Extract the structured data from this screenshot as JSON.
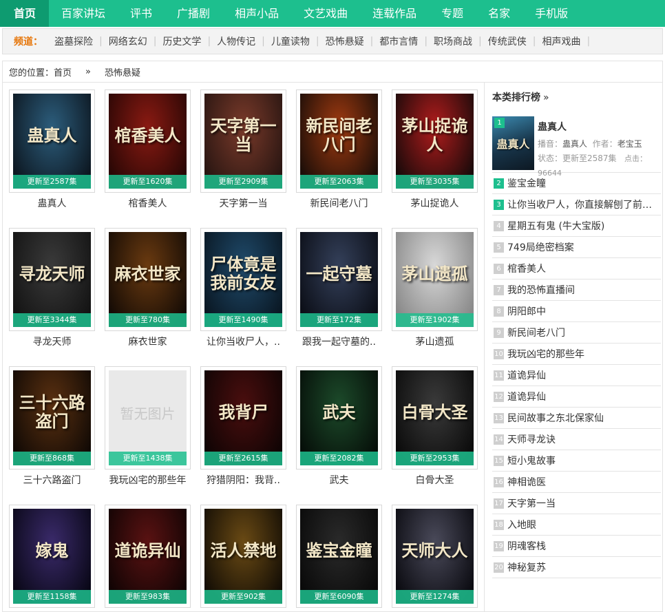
{
  "nav": [
    {
      "label": "首页",
      "active": true
    },
    {
      "label": "百家讲坛"
    },
    {
      "label": "评书"
    },
    {
      "label": "广播剧"
    },
    {
      "label": "相声小品"
    },
    {
      "label": "文艺戏曲"
    },
    {
      "label": "连载作品"
    },
    {
      "label": "专题"
    },
    {
      "label": "名家"
    },
    {
      "label": "手机版"
    }
  ],
  "channel": {
    "label": "频道：",
    "items": [
      "盗墓探险",
      "网络玄幻",
      "历史文学",
      "人物传记",
      "儿童读物",
      "恐怖悬疑",
      "都市言情",
      "职场商战",
      "传统武侠",
      "相声戏曲"
    ]
  },
  "breadcrumb": {
    "prefix": "您的位置：",
    "home": "首页",
    "arrow": "»",
    "current": "恐怖悬疑"
  },
  "books": [
    {
      "title": "蛊真人",
      "update": "更新至2587集",
      "art": "蛊真人",
      "bg": [
        "#2c5d7c",
        "#0d1822"
      ]
    },
    {
      "title": "棺香美人",
      "update": "更新至1620集",
      "art": "棺香美人",
      "bg": [
        "#8a1a12",
        "#2a0705"
      ]
    },
    {
      "title": "天字第一当",
      "update": "更新至2909集",
      "art": "天字第一当",
      "bg": [
        "#7a3a2a",
        "#2a1612"
      ]
    },
    {
      "title": "新民间老八门",
      "update": "更新至2063集",
      "art": "新民间老八门",
      "bg": [
        "#a03a10",
        "#1c0e08"
      ]
    },
    {
      "title": "茅山捉诡人",
      "update": "更新至3035集",
      "art": "茅山捉诡人",
      "bg": [
        "#b01c1c",
        "#1a0a0a"
      ]
    },
    {
      "title": "寻龙天师",
      "update": "更新至3344集",
      "art": "寻龙天师",
      "bg": [
        "#3a3a3a",
        "#141414"
      ]
    },
    {
      "title": "麻衣世家",
      "update": "更新至780集",
      "art": "麻衣世家",
      "bg": [
        "#6a3a10",
        "#160c05"
      ]
    },
    {
      "title": "让你当收尸人，..",
      "update": "更新至1490集",
      "art": "尸体竟是我前女友",
      "bg": [
        "#1f4a6a",
        "#0a1824"
      ]
    },
    {
      "title": "跟我一起守墓的..",
      "update": "更新至172集",
      "art": "一起守墓",
      "bg": [
        "#34405a",
        "#0c0f18"
      ]
    },
    {
      "title": "茅山遗孤",
      "update": "更新至1902集",
      "art": "茅山遗孤",
      "bg": [
        "#d8d8d8",
        "#8a8a8a"
      ]
    },
    {
      "title": "三十六路盗门",
      "update": "更新至868集",
      "art": "三十六路盗门",
      "bg": [
        "#5a3010",
        "#120a05"
      ]
    },
    {
      "title": "我玩凶宅的那些年",
      "update": "更新至1438集",
      "art": "",
      "noimg": true,
      "noimg_text": "暂无图片"
    },
    {
      "title": "狩猎阴阳：我背..",
      "update": "更新至2615集",
      "art": "我背尸",
      "bg": [
        "#4a0e0e",
        "#100404"
      ]
    },
    {
      "title": "武夫",
      "update": "更新至2082集",
      "art": "武夫",
      "bg": [
        "#1c4a2a",
        "#060f09"
      ]
    },
    {
      "title": "白骨大圣",
      "update": "更新至2953集",
      "art": "白骨大圣",
      "bg": [
        "#3a3a3a",
        "#0c0c0c"
      ]
    },
    {
      "title": "",
      "update": "更新至1158集",
      "art": "嫁鬼",
      "bg": [
        "#3a2a6a",
        "#0a0818"
      ]
    },
    {
      "title": "",
      "update": "更新至983集",
      "art": "道诡异仙",
      "bg": [
        "#5a1212",
        "#120404"
      ]
    },
    {
      "title": "",
      "update": "更新至902集",
      "art": "活人禁地",
      "bg": [
        "#6a4a14",
        "#140e05"
      ]
    },
    {
      "title": "",
      "update": "更新至6090集",
      "art": "鉴宝金瞳",
      "bg": [
        "#2a2a2a",
        "#0a0a0a"
      ]
    },
    {
      "title": "",
      "update": "更新至1274集",
      "art": "天师大人",
      "bg": [
        "#4a4a5a",
        "#0c0c12"
      ]
    }
  ],
  "ranking": {
    "title": "本类排行榜",
    "chevron": "»",
    "top": {
      "rank": "1",
      "name": "蛊真人",
      "anchor_label": "播音：",
      "anchor": "蛊真人",
      "author_label": "作者：",
      "author": "老宝玉",
      "status_label": "状态：",
      "status": "更新至2587集",
      "clicks_label": "点击：",
      "clicks": "96644",
      "thumb_art": "蛊真人"
    },
    "items": [
      {
        "rank": "2",
        "name": "鉴宝金瞳"
      },
      {
        "rank": "3",
        "name": "让你当收尸人，你直接解刨了前…"
      },
      {
        "rank": "4",
        "name": "星期五有鬼 (牛大宝版)"
      },
      {
        "rank": "5",
        "name": "749局绝密档案"
      },
      {
        "rank": "6",
        "name": "棺香美人"
      },
      {
        "rank": "7",
        "name": "我的恐怖直播间"
      },
      {
        "rank": "8",
        "name": "阴阳郎中"
      },
      {
        "rank": "9",
        "name": "新民间老八门"
      },
      {
        "rank": "10",
        "name": "我玩凶宅的那些年"
      },
      {
        "rank": "11",
        "name": "道诡异仙"
      },
      {
        "rank": "12",
        "name": "道诡异仙"
      },
      {
        "rank": "13",
        "name": "民间故事之东北保家仙"
      },
      {
        "rank": "14",
        "name": "天师寻龙诀"
      },
      {
        "rank": "15",
        "name": "短小鬼故事"
      },
      {
        "rank": "16",
        "name": "神相诡医"
      },
      {
        "rank": "17",
        "name": "天字第一当"
      },
      {
        "rank": "18",
        "name": "入地眼"
      },
      {
        "rank": "19",
        "name": "阴魂客栈"
      },
      {
        "rank": "20",
        "name": "神秘复苏"
      }
    ]
  },
  "colors": {
    "brand": "#1dbf8e",
    "brand_dark": "#0e9b70",
    "channel_label": "#e6770c"
  }
}
